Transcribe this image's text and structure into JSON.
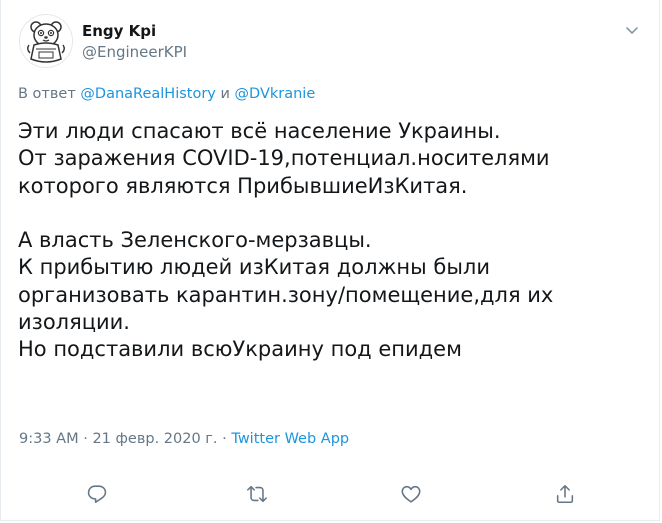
{
  "author": {
    "display_name": "Engy Kpi",
    "handle": "@EngineerKPI"
  },
  "reply": {
    "prefix": "В ответ ",
    "user1": "@DanaRealHistory",
    "conjunction": " и ",
    "user2": "@DVkranie"
  },
  "tweet_lines": [
    "Эти люди спасают всё население Украины.",
    "От заражения COVID-19,потенциал.носителями",
    "которого являются ПрибывшиеИзКитая.",
    "",
    "А власть Зеленского-мерзавцы.",
    "К прибытию людей изКитая должны были",
    "организовать карантин.зону/помещение,для их",
    "изоляции.",
    "Но подставили всюУкраину под епидем"
  ],
  "meta": {
    "time": "9:33 AM",
    "separator": " · ",
    "date": "21 февр. 2020 г.",
    "source": "Twitter Web App"
  },
  "icons": {
    "caret": "chevron-down-icon",
    "reply": "reply-icon",
    "retweet": "retweet-icon",
    "like": "heart-icon",
    "share": "share-icon"
  },
  "colors": {
    "link": "#1b95e0",
    "secondary_text": "#657786",
    "primary_text": "#14171a",
    "border": "#e6ecf0"
  }
}
